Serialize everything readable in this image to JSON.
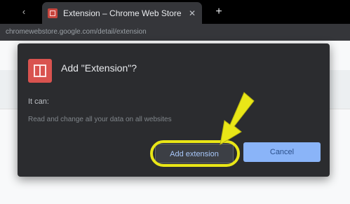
{
  "browser": {
    "tab_title": "Extension – Chrome Web Store",
    "tab_close_glyph": "✕",
    "new_tab_glyph": "+",
    "scroll_glyph": "‹",
    "address_text": "chromewebstore.google.com/detail/extension"
  },
  "dialog": {
    "title": "Add \"Extension\"?",
    "subtitle": "It can:",
    "description": "Read and change all your data on all websites",
    "secondary_button": "Add extension",
    "primary_button": "Cancel"
  },
  "colors": {
    "annotation": "#e9e617",
    "primary_button": "#8ab4f8",
    "dialog_background": "#2b2c2f"
  },
  "icons": {
    "favicon": "extension-favicon-icon",
    "app": "extension-app-icon",
    "annotation": "arrow-icon"
  }
}
